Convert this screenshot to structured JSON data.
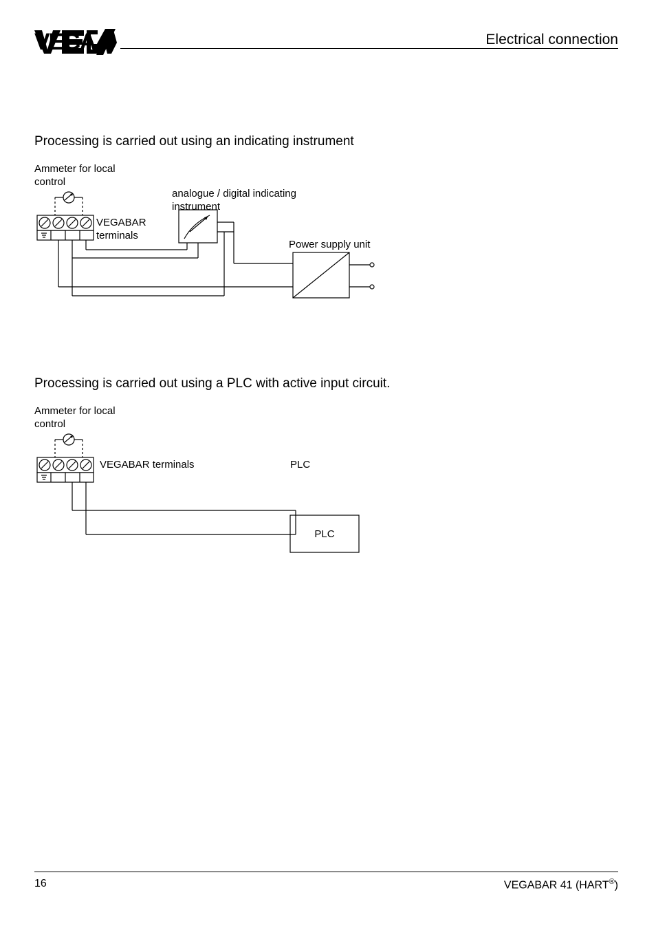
{
  "header": {
    "title": "Electrical connection"
  },
  "section1": {
    "heading": "Processing is carried out using an indicating instrument",
    "labels": {
      "ammeter": "Ammeter for local control",
      "terminals": "VEGABAR terminals",
      "indicator": "analogue / digital indicating instrument",
      "psu": "Power supply unit"
    }
  },
  "section2": {
    "heading": "Processing is carried out using a PLC with active input circuit.",
    "labels": {
      "ammeter": "Ammeter for local control",
      "terminals": "VEGABAR terminals",
      "plc_top": "PLC",
      "plc_box": "PLC"
    }
  },
  "footer": {
    "page": "16",
    "doc_prefix": "VEGABAR 41 (HART",
    "doc_sup": "®",
    "doc_suffix": ")"
  }
}
